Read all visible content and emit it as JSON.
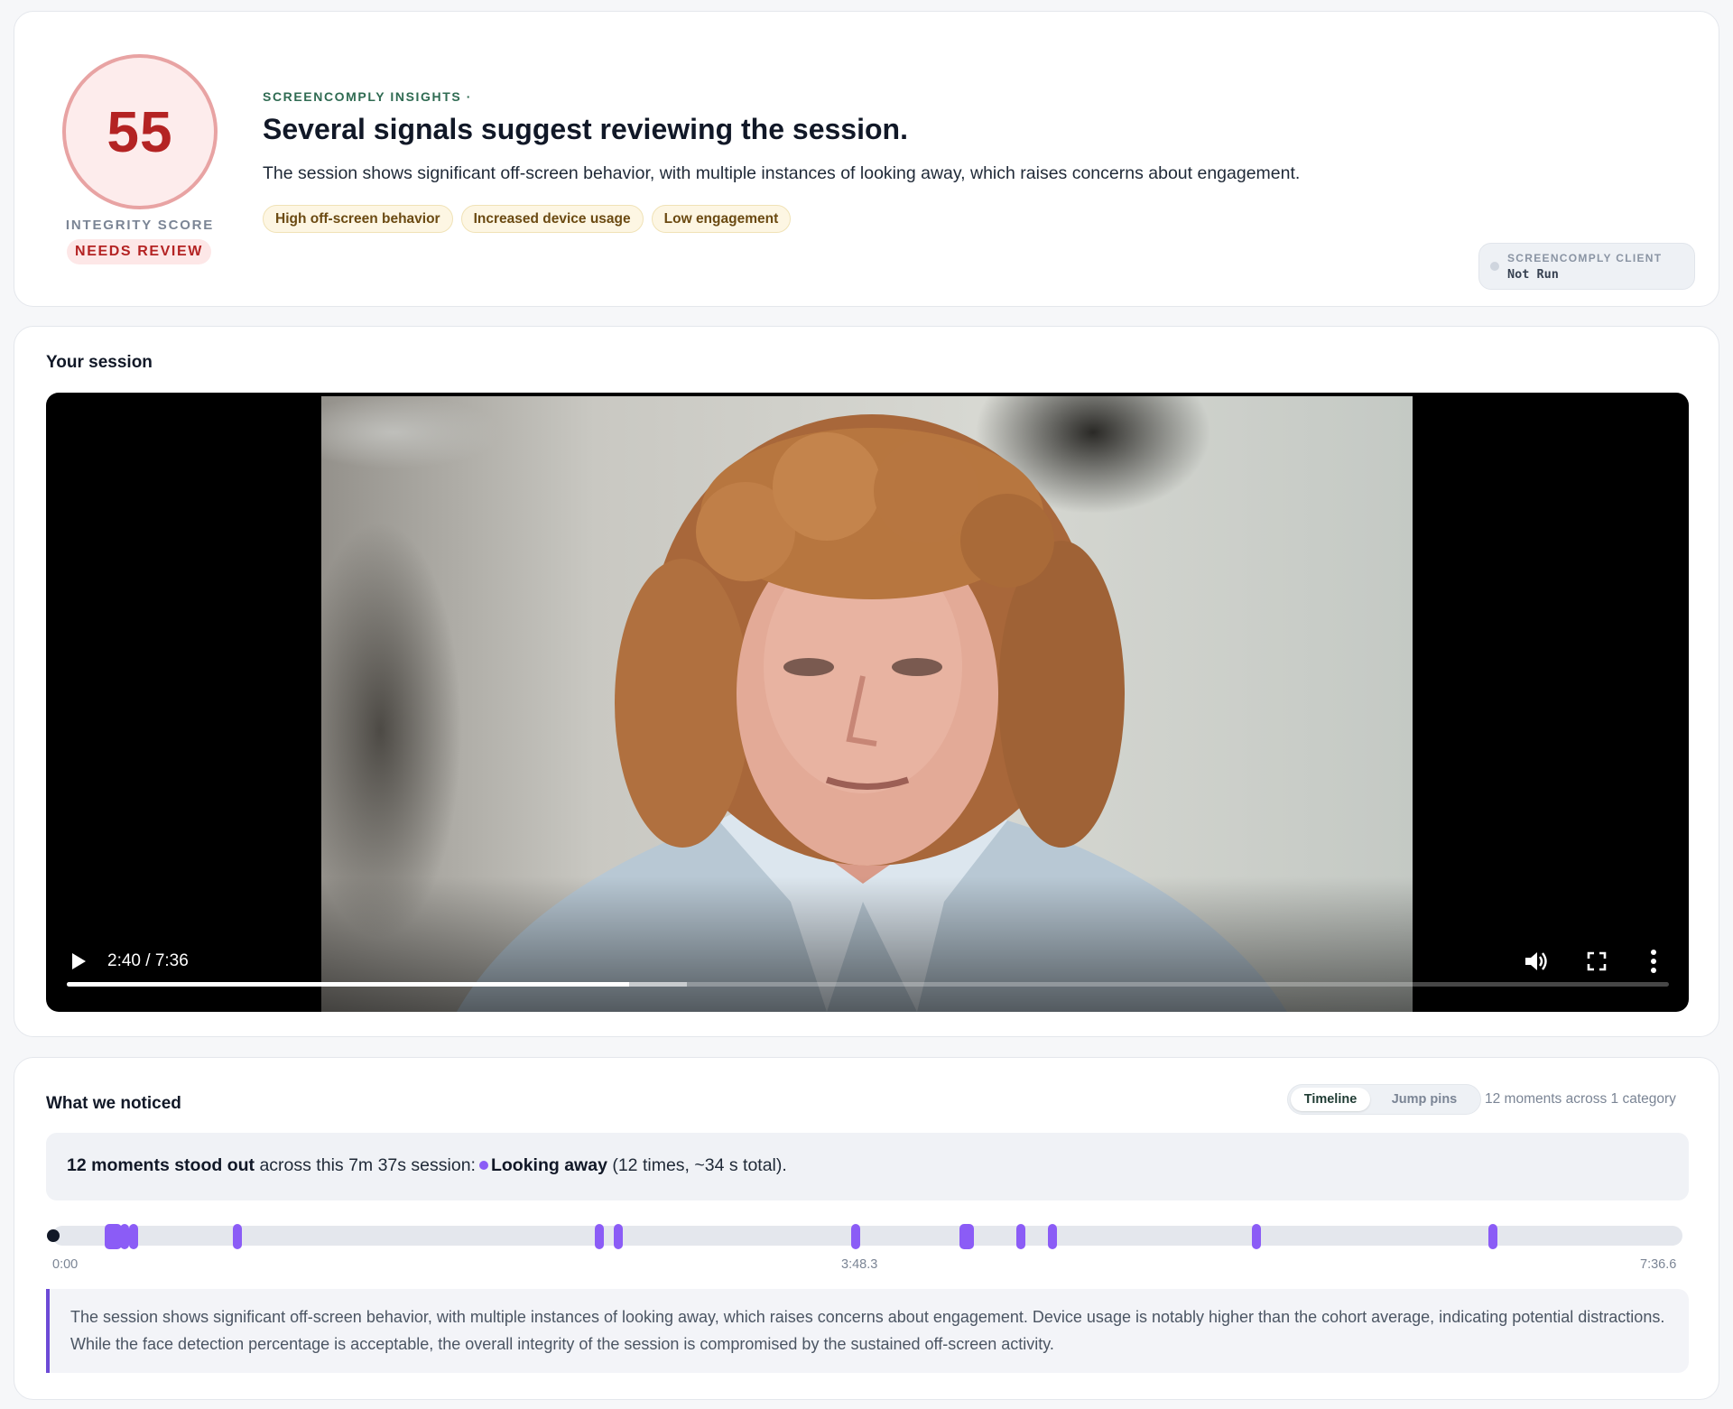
{
  "insights": {
    "score": "55",
    "score_label": "INTEGRITY SCORE",
    "status_badge": "NEEDS REVIEW",
    "eyebrow": "SCREENCOMPLY INSIGHTS ·",
    "headline": "Several signals suggest reviewing the session.",
    "summary": "The session shows significant off-screen behavior, with multiple instances of looking away, which raises concerns about engagement.",
    "tags": [
      "High off-screen behavior",
      "Increased device usage",
      "Low engagement"
    ],
    "client": {
      "label": "SCREENCOMPLY CLIENT",
      "status": "Not Run"
    }
  },
  "session": {
    "title": "Your session",
    "player": {
      "time_label": "2:40 / 7:36",
      "played_fraction": 0.351,
      "buffered_fraction": 0.387,
      "controls": [
        "play-icon",
        "volume-icon",
        "fullscreen-icon",
        "more-options-icon"
      ]
    }
  },
  "noticed": {
    "title": "What we noticed",
    "view_toggle": {
      "options": [
        "Timeline",
        "Jump pins"
      ],
      "selected": "Timeline"
    },
    "moments_caption": "12 moments across 1 category",
    "summary": {
      "count_text": "12 moments stood out",
      "middle_text": "across this 7m 37s session:",
      "category": "Looking away",
      "detail": "(12 times, ~34 s total)."
    },
    "timeline": {
      "duration_seconds": 456.6,
      "playhead_seconds": 0,
      "tick_labels": [
        "0:00",
        "3:48.3",
        "7:36.6"
      ],
      "tick_seconds": [
        0,
        228.3,
        456.6
      ],
      "pins_seconds": [
        15.4,
        18.5,
        21.2,
        50.5,
        152.7,
        158.0,
        224.9,
        256.3,
        271.5,
        280.6,
        338.2,
        404.9
      ],
      "pin_duration_seconds": [
        5.0,
        2.5,
        2.5,
        2.5,
        2.5,
        2.5,
        2.5,
        4.0,
        2.5,
        2.5,
        2.5,
        2.5
      ],
      "pin_color": "#8b5cf6"
    },
    "note": "The session shows significant off-screen behavior, with multiple instances of looking away, which raises concerns about engagement. Device usage is notably higher than the cohort average, indicating potential distractions. While the face detection percentage is acceptable, the overall integrity of the session is compromised by the sustained off-screen activity."
  },
  "colors": {
    "score_red": "#b42323",
    "accent_green": "#2f6b52",
    "pin_purple": "#8b5cf6",
    "note_border": "#6c4ad6"
  }
}
